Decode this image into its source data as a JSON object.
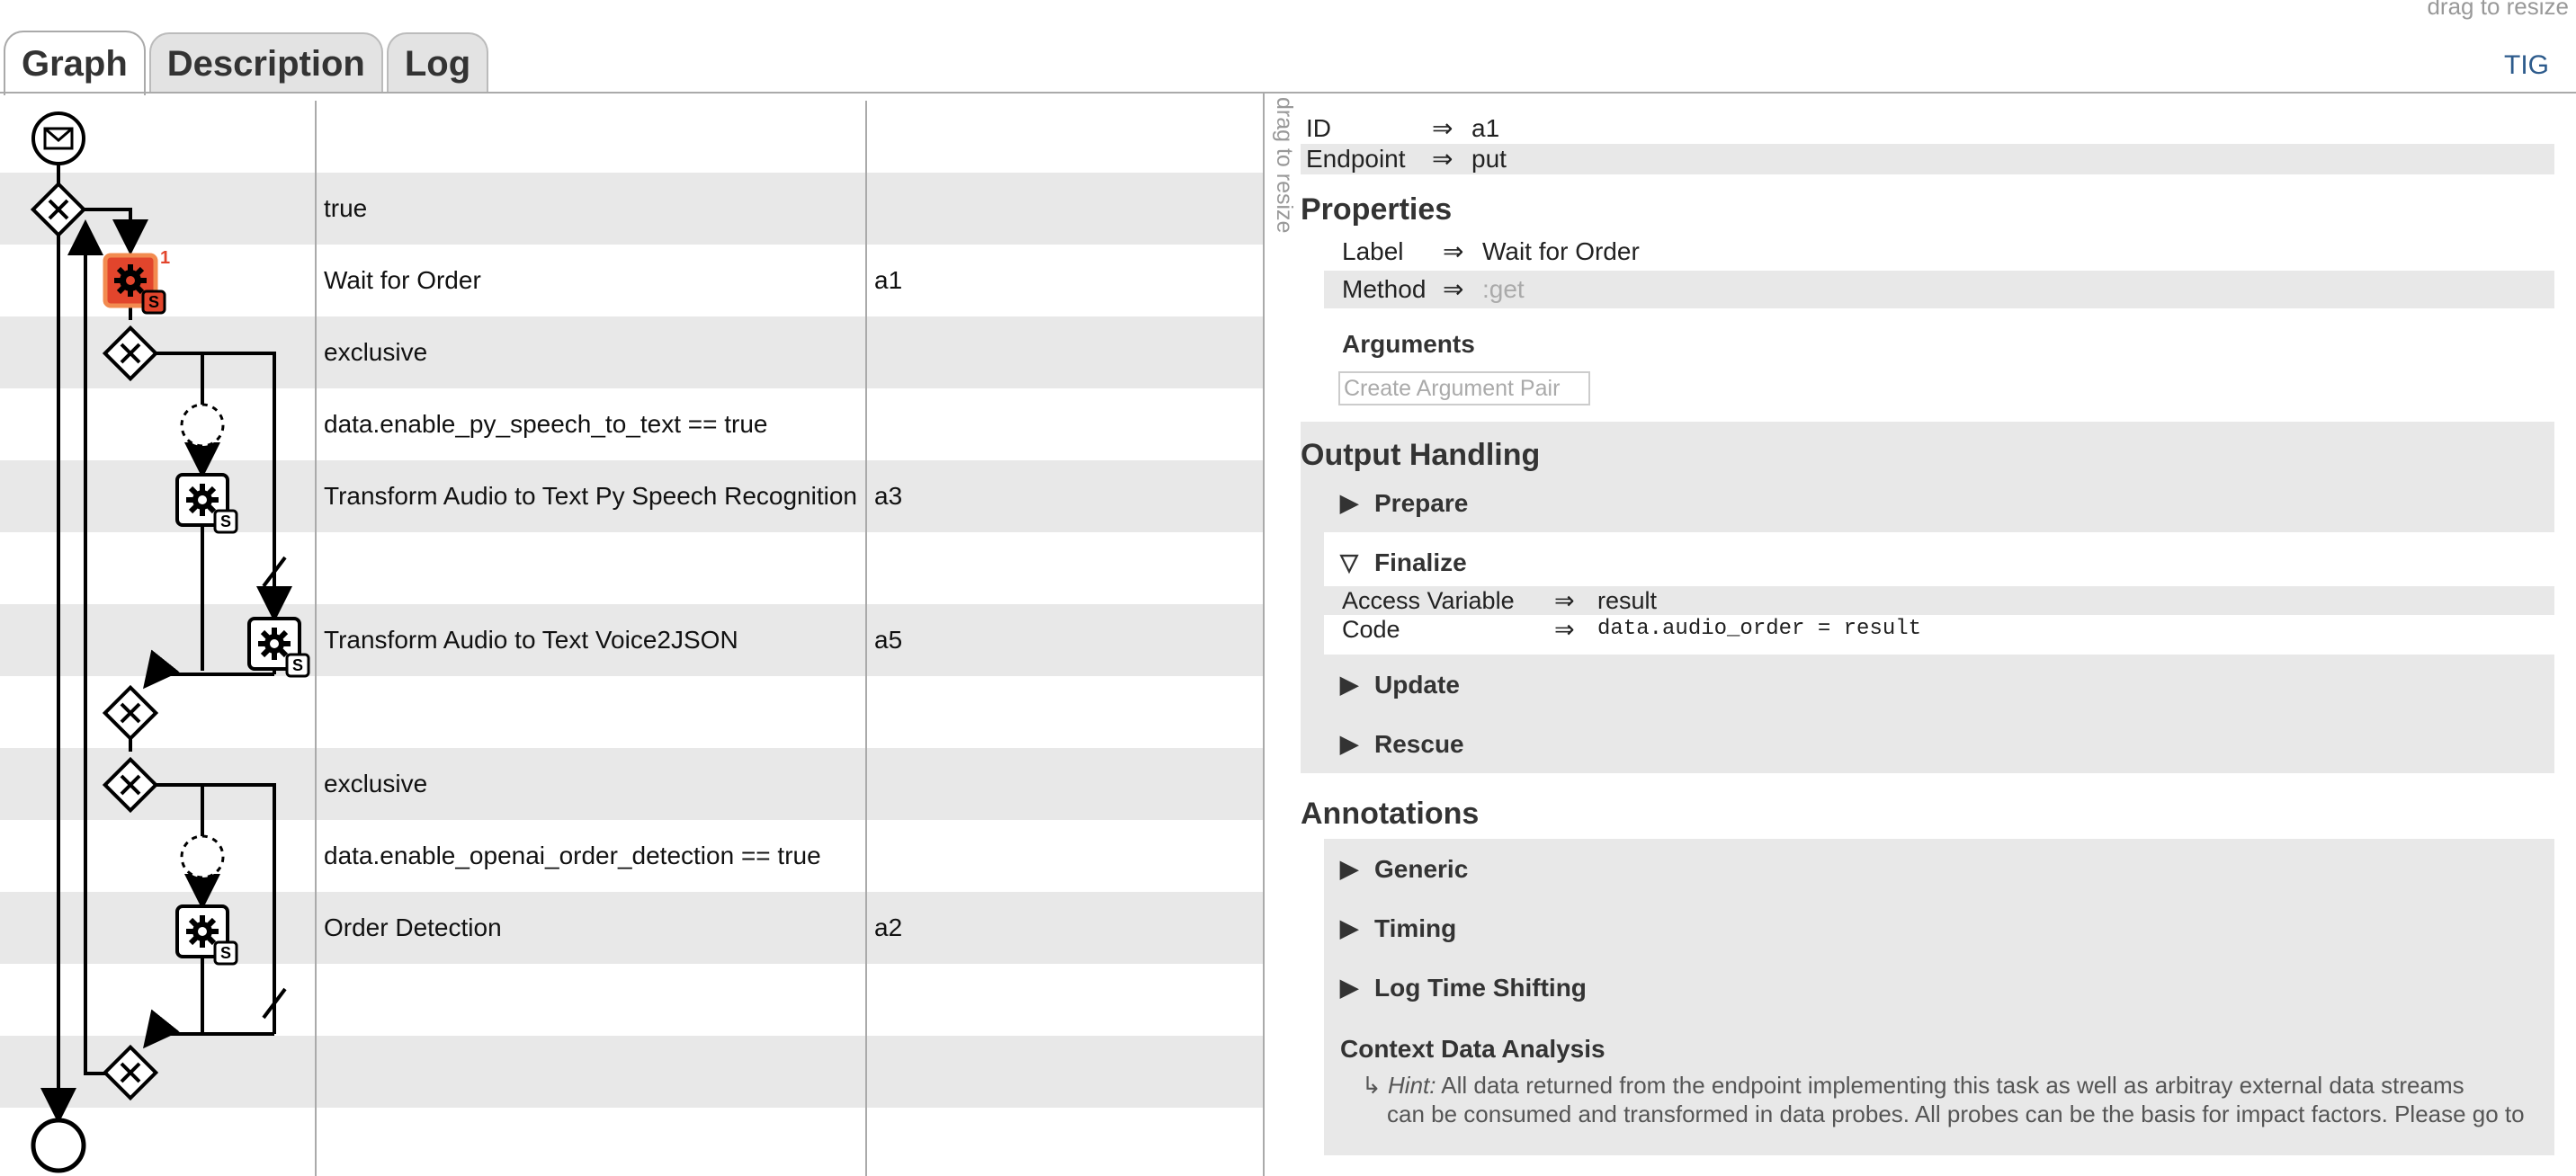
{
  "top": {
    "drag_hint": "drag to resize",
    "tig_link": "TIG"
  },
  "tabs": [
    {
      "label": "Graph",
      "active": true
    },
    {
      "label": "Description",
      "active": false
    },
    {
      "label": "Log",
      "active": false
    }
  ],
  "graph": {
    "rows": [
      {
        "label": "",
        "id": ""
      },
      {
        "label": "true",
        "id": ""
      },
      {
        "label": "Wait for Order",
        "id": "a1"
      },
      {
        "label": "exclusive",
        "id": ""
      },
      {
        "label": "data.enable_py_speech_to_text == true",
        "id": ""
      },
      {
        "label": "Transform Audio to Text Py Speech Recognition",
        "id": "a3"
      },
      {
        "label": "",
        "id": ""
      },
      {
        "label": "Transform Audio to Text Voice2JSON",
        "id": "a5"
      },
      {
        "label": "",
        "id": ""
      },
      {
        "label": "exclusive",
        "id": ""
      },
      {
        "label": "data.enable_openai_order_detection == true",
        "id": ""
      },
      {
        "label": "Order Detection",
        "id": "a2"
      },
      {
        "label": "",
        "id": ""
      },
      {
        "label": "",
        "id": ""
      },
      {
        "label": "",
        "id": ""
      }
    ],
    "badge_count": "1",
    "service_marker": "S",
    "colors": {
      "active_task": "#e2452c",
      "active_border": "#f28b50"
    }
  },
  "panel": {
    "side_drag_hint": "drag to resize",
    "id_row": {
      "key": "ID",
      "arrow": "⇒",
      "value": "a1"
    },
    "endpoint_row": {
      "key": "Endpoint",
      "arrow": "⇒",
      "value": "put"
    },
    "properties": {
      "heading": "Properties",
      "label_row": {
        "key": "Label",
        "arrow": "⇒",
        "value": "Wait for Order"
      },
      "method_row": {
        "key": "Method",
        "arrow": "⇒",
        "value": ":get"
      },
      "arguments_heading": "Arguments",
      "create_button": "Create Argument Pair"
    },
    "output_handling": {
      "heading": "Output Handling",
      "prepare": {
        "tri": "▶",
        "label": "Prepare"
      },
      "finalize": {
        "tri": "▽",
        "label": "Finalize",
        "access_row": {
          "key": "Access Variable",
          "arrow": "⇒",
          "value": "result"
        },
        "code_row": {
          "key": "Code",
          "arrow": "⇒",
          "value": "data.audio_order = result"
        }
      },
      "update": {
        "tri": "▶",
        "label": "Update"
      },
      "rescue": {
        "tri": "▶",
        "label": "Rescue"
      }
    },
    "annotations": {
      "heading": "Annotations",
      "generic": {
        "tri": "▶",
        "label": "Generic"
      },
      "timing": {
        "tri": "▶",
        "label": "Timing"
      },
      "log_time": {
        "tri": "▶",
        "label": "Log Time Shifting"
      },
      "context": {
        "heading": "Context Data Analysis",
        "hint_prefix": "↳",
        "hint_label": "Hint:",
        "hint_line1": "All data returned from the endpoint implementing this task as well as arbitray external data streams",
        "hint_line2": "can be consumed and transformed in data probes. All probes can be the basis for impact factors. Please go to"
      }
    }
  }
}
